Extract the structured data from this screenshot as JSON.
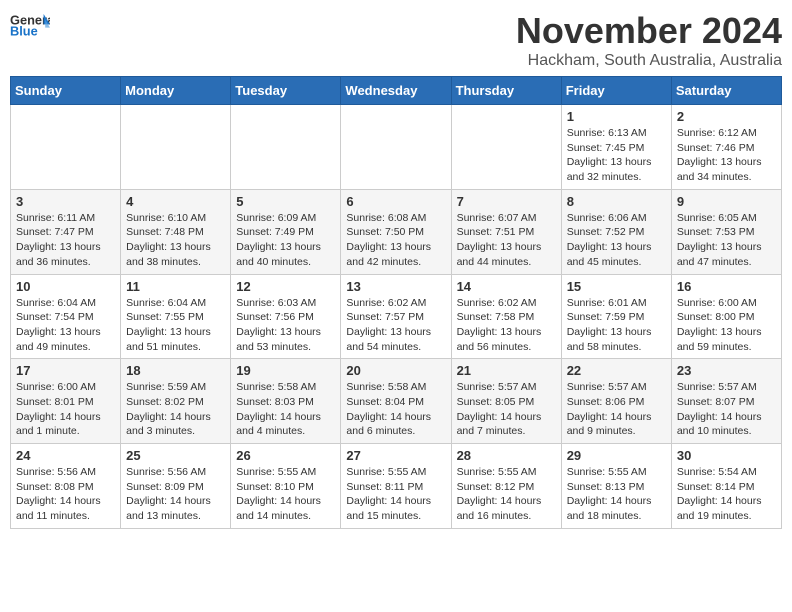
{
  "header": {
    "logo_general": "General",
    "logo_blue": "Blue",
    "month_year": "November 2024",
    "location": "Hackham, South Australia, Australia"
  },
  "days_of_week": [
    "Sunday",
    "Monday",
    "Tuesday",
    "Wednesday",
    "Thursday",
    "Friday",
    "Saturday"
  ],
  "weeks": [
    [
      {
        "day": "",
        "info": ""
      },
      {
        "day": "",
        "info": ""
      },
      {
        "day": "",
        "info": ""
      },
      {
        "day": "",
        "info": ""
      },
      {
        "day": "",
        "info": ""
      },
      {
        "day": "1",
        "info": "Sunrise: 6:13 AM\nSunset: 7:45 PM\nDaylight: 13 hours and 32 minutes."
      },
      {
        "day": "2",
        "info": "Sunrise: 6:12 AM\nSunset: 7:46 PM\nDaylight: 13 hours and 34 minutes."
      }
    ],
    [
      {
        "day": "3",
        "info": "Sunrise: 6:11 AM\nSunset: 7:47 PM\nDaylight: 13 hours and 36 minutes."
      },
      {
        "day": "4",
        "info": "Sunrise: 6:10 AM\nSunset: 7:48 PM\nDaylight: 13 hours and 38 minutes."
      },
      {
        "day": "5",
        "info": "Sunrise: 6:09 AM\nSunset: 7:49 PM\nDaylight: 13 hours and 40 minutes."
      },
      {
        "day": "6",
        "info": "Sunrise: 6:08 AM\nSunset: 7:50 PM\nDaylight: 13 hours and 42 minutes."
      },
      {
        "day": "7",
        "info": "Sunrise: 6:07 AM\nSunset: 7:51 PM\nDaylight: 13 hours and 44 minutes."
      },
      {
        "day": "8",
        "info": "Sunrise: 6:06 AM\nSunset: 7:52 PM\nDaylight: 13 hours and 45 minutes."
      },
      {
        "day": "9",
        "info": "Sunrise: 6:05 AM\nSunset: 7:53 PM\nDaylight: 13 hours and 47 minutes."
      }
    ],
    [
      {
        "day": "10",
        "info": "Sunrise: 6:04 AM\nSunset: 7:54 PM\nDaylight: 13 hours and 49 minutes."
      },
      {
        "day": "11",
        "info": "Sunrise: 6:04 AM\nSunset: 7:55 PM\nDaylight: 13 hours and 51 minutes."
      },
      {
        "day": "12",
        "info": "Sunrise: 6:03 AM\nSunset: 7:56 PM\nDaylight: 13 hours and 53 minutes."
      },
      {
        "day": "13",
        "info": "Sunrise: 6:02 AM\nSunset: 7:57 PM\nDaylight: 13 hours and 54 minutes."
      },
      {
        "day": "14",
        "info": "Sunrise: 6:02 AM\nSunset: 7:58 PM\nDaylight: 13 hours and 56 minutes."
      },
      {
        "day": "15",
        "info": "Sunrise: 6:01 AM\nSunset: 7:59 PM\nDaylight: 13 hours and 58 minutes."
      },
      {
        "day": "16",
        "info": "Sunrise: 6:00 AM\nSunset: 8:00 PM\nDaylight: 13 hours and 59 minutes."
      }
    ],
    [
      {
        "day": "17",
        "info": "Sunrise: 6:00 AM\nSunset: 8:01 PM\nDaylight: 14 hours and 1 minute."
      },
      {
        "day": "18",
        "info": "Sunrise: 5:59 AM\nSunset: 8:02 PM\nDaylight: 14 hours and 3 minutes."
      },
      {
        "day": "19",
        "info": "Sunrise: 5:58 AM\nSunset: 8:03 PM\nDaylight: 14 hours and 4 minutes."
      },
      {
        "day": "20",
        "info": "Sunrise: 5:58 AM\nSunset: 8:04 PM\nDaylight: 14 hours and 6 minutes."
      },
      {
        "day": "21",
        "info": "Sunrise: 5:57 AM\nSunset: 8:05 PM\nDaylight: 14 hours and 7 minutes."
      },
      {
        "day": "22",
        "info": "Sunrise: 5:57 AM\nSunset: 8:06 PM\nDaylight: 14 hours and 9 minutes."
      },
      {
        "day": "23",
        "info": "Sunrise: 5:57 AM\nSunset: 8:07 PM\nDaylight: 14 hours and 10 minutes."
      }
    ],
    [
      {
        "day": "24",
        "info": "Sunrise: 5:56 AM\nSunset: 8:08 PM\nDaylight: 14 hours and 11 minutes."
      },
      {
        "day": "25",
        "info": "Sunrise: 5:56 AM\nSunset: 8:09 PM\nDaylight: 14 hours and 13 minutes."
      },
      {
        "day": "26",
        "info": "Sunrise: 5:55 AM\nSunset: 8:10 PM\nDaylight: 14 hours and 14 minutes."
      },
      {
        "day": "27",
        "info": "Sunrise: 5:55 AM\nSunset: 8:11 PM\nDaylight: 14 hours and 15 minutes."
      },
      {
        "day": "28",
        "info": "Sunrise: 5:55 AM\nSunset: 8:12 PM\nDaylight: 14 hours and 16 minutes."
      },
      {
        "day": "29",
        "info": "Sunrise: 5:55 AM\nSunset: 8:13 PM\nDaylight: 14 hours and 18 minutes."
      },
      {
        "day": "30",
        "info": "Sunrise: 5:54 AM\nSunset: 8:14 PM\nDaylight: 14 hours and 19 minutes."
      }
    ]
  ]
}
